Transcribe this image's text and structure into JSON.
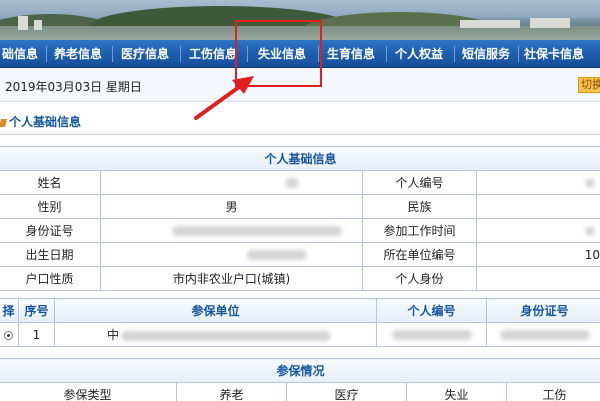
{
  "nav": {
    "items": [
      {
        "label": "础信息"
      },
      {
        "label": "养老信息"
      },
      {
        "label": "医疗信息"
      },
      {
        "label": "工伤信息"
      },
      {
        "label": "失业信息"
      },
      {
        "label": "生育信息"
      },
      {
        "label": "个人权益"
      },
      {
        "label": "短信服务"
      },
      {
        "label": "社保卡信息"
      }
    ]
  },
  "datebar": {
    "date": "2019年03月03日 星期日",
    "switch_label": "切换"
  },
  "section": {
    "title": "个人基础信息"
  },
  "basic_table": {
    "caption": "个人基础信息",
    "rows": [
      {
        "l1": "姓名",
        "v1": "",
        "l2": "个人编号",
        "v2": ""
      },
      {
        "l1": "性别",
        "v1": "男",
        "l2": "民族",
        "v2": ""
      },
      {
        "l1": "身份证号",
        "v1": "",
        "l2": "参加工作时间",
        "v2": ""
      },
      {
        "l1": "出生日期",
        "v1": "",
        "l2": "所在单位编号",
        "v2": "10"
      },
      {
        "l1": "户口性质",
        "v1": "市内非农业户口(城镇)",
        "l2": "个人身份",
        "v2": ""
      }
    ]
  },
  "unit_table": {
    "headers": {
      "select": "择",
      "seq": "序号",
      "unit": "参保单位",
      "person_no": "个人编号",
      "id_no": "身份证号"
    },
    "rows": [
      {
        "seq": "1",
        "unit": "中"
      }
    ]
  },
  "insurance_table": {
    "caption": "参保情况",
    "headers": {
      "type": "参保类型",
      "pension": "养老",
      "medical": "医疗",
      "unemployment": "失业",
      "injury": "工伤"
    }
  },
  "colors": {
    "nav_bg": "#1f5fae",
    "header_text": "#17579f",
    "highlight": "#e02020",
    "switch_bg": "#f6c24b"
  }
}
